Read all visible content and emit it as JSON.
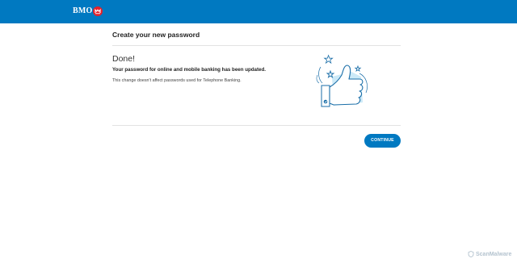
{
  "header": {
    "brand": "BMO",
    "logo_icon": "bmo-roundel-icon",
    "color": "#0079c1"
  },
  "main": {
    "title": "Create your new password",
    "heading": "Done!",
    "message": "Your password for online and mobile banking has been updated.",
    "note": "This change doesn't affect passwords used for Telephone Banking.",
    "illustration": "thumbs-up-icon",
    "continue_label": "CONTINUE"
  },
  "watermark": {
    "text": "ScanMalware"
  },
  "colors": {
    "accent": "#0079c1",
    "logo_red": "#e4212a"
  }
}
